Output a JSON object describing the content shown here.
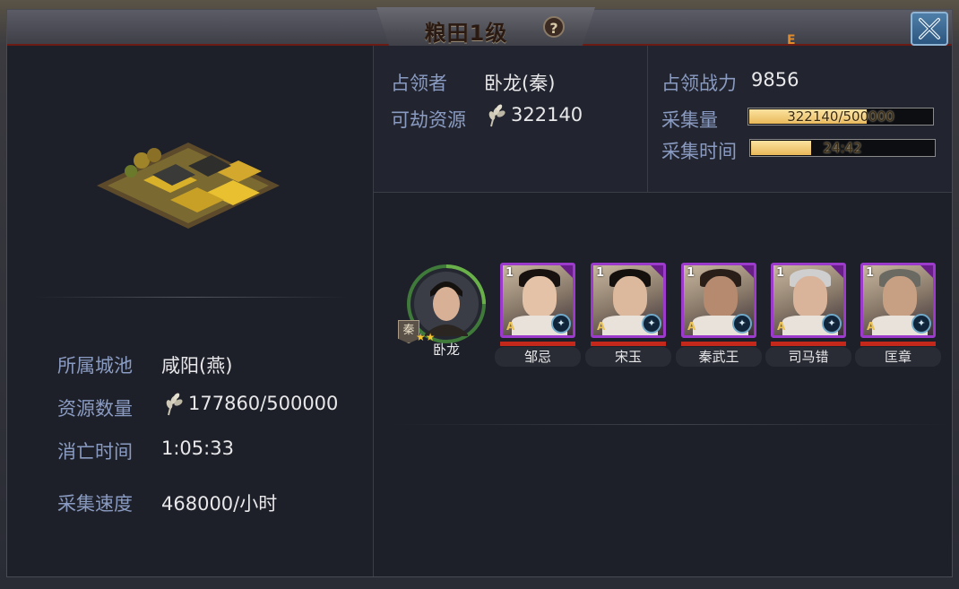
{
  "title": "粮田1级",
  "help_icon": "question-icon",
  "close_icon": "close-x-icon",
  "occupant": {
    "label": "占领者",
    "value": "卧龙(秦)"
  },
  "plunderable": {
    "label": "可劫资源",
    "value": "322140",
    "icon": "wheat-icon"
  },
  "power": {
    "label": "占领战力",
    "value": "9856"
  },
  "collect_amount": {
    "label": "采集量",
    "text": "322140/500000",
    "fraction": 0.644
  },
  "collect_time": {
    "label": "采集时间",
    "text": "24:42",
    "fraction": 0.33
  },
  "city": {
    "label": "所属城池",
    "value": "咸阳(燕)"
  },
  "resource_count": {
    "label": "资源数量",
    "value": "177860/500000",
    "icon": "wheat-icon"
  },
  "expire_time": {
    "label": "消亡时间",
    "value": "1:05:33"
  },
  "collect_speed": {
    "label": "采集速度",
    "value": "468000/小时"
  },
  "leader": {
    "name": "卧龙",
    "faction": "秦",
    "stars": 2
  },
  "heroes": [
    {
      "level": "1",
      "name": "邹忌"
    },
    {
      "level": "1",
      "name": "宋玉"
    },
    {
      "level": "1",
      "name": "秦武王"
    },
    {
      "level": "1",
      "name": "司马错"
    },
    {
      "level": "1",
      "name": "匡章"
    }
  ],
  "colors": {
    "label": "#8a9bc2",
    "value": "#e8e8ea",
    "card_border": "#9c3acb",
    "bar_fill": "#e9b85a"
  }
}
